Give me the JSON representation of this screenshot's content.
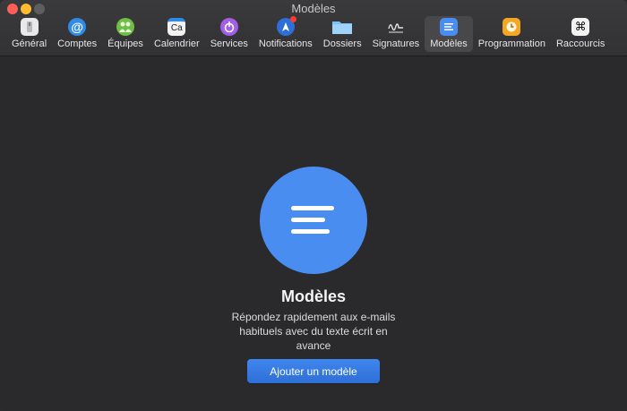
{
  "window": {
    "title": "Modèles"
  },
  "toolbar": {
    "items": [
      {
        "label": "Général",
        "icon": "general-icon"
      },
      {
        "label": "Comptes",
        "icon": "at-icon"
      },
      {
        "label": "Équipes",
        "icon": "teams-icon"
      },
      {
        "label": "Calendrier",
        "icon": "calendar-icon",
        "icon_text": "Ca"
      },
      {
        "label": "Services",
        "icon": "services-icon"
      },
      {
        "label": "Notifications",
        "icon": "notifications-icon"
      },
      {
        "label": "Dossiers",
        "icon": "folder-icon"
      },
      {
        "label": "Signatures",
        "icon": "signature-icon"
      },
      {
        "label": "Modèles",
        "icon": "templates-icon",
        "selected": true
      },
      {
        "label": "Programmation",
        "icon": "clock-icon"
      },
      {
        "label": "Raccourcis",
        "icon": "command-icon",
        "icon_text": "⌘"
      }
    ]
  },
  "main": {
    "title": "Modèles",
    "description": "Répondez rapidement aux e-mails habituels avec du texte écrit en avance",
    "button": "Ajouter un modèle"
  },
  "colors": {
    "accent": "#4a8df0",
    "background": "#2a2a2c"
  }
}
